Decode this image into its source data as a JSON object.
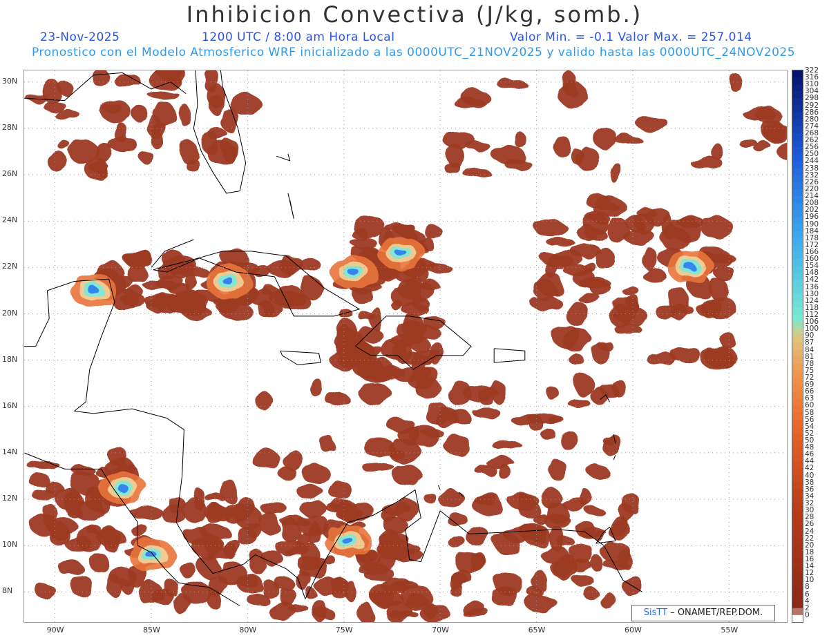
{
  "header": {
    "title": "Inhibicion Convectiva (J/kg, somb.)",
    "date": "23-Nov-2025",
    "time": "1200 UTC / 8:00 am Hora Local",
    "minmax": "Valor Min. = -0.1  Valor Max. = 257.014",
    "model_info": "Pronostico con el Modelo Atmosferico WRF inicializado a las 0000UTC_21NOV2025 y valido hasta las  0000UTC_24NOV2025"
  },
  "map": {
    "lat_labels": [
      "30N",
      "28N",
      "26N",
      "24N",
      "22N",
      "20N",
      "18N",
      "16N",
      "14N",
      "12N",
      "10N",
      "8N"
    ],
    "lon_labels": [
      "90W",
      "85W",
      "80W",
      "75W",
      "70W",
      "65W",
      "60W",
      "55W"
    ],
    "lat_values": [
      30,
      28,
      26,
      24,
      22,
      20,
      18,
      16,
      14,
      12,
      10,
      8
    ],
    "lon_values": [
      -90,
      -85,
      -80,
      -75,
      -70,
      -65,
      -60,
      -55
    ],
    "lon_range": [
      -91.6,
      -52.0
    ],
    "lat_range": [
      6.7,
      30.5
    ]
  },
  "colorbar": {
    "labels": [
      "322",
      "316",
      "310",
      "304",
      "298",
      "292",
      "286",
      "280",
      "274",
      "268",
      "262",
      "256",
      "250",
      "244",
      "238",
      "232",
      "226",
      "220",
      "214",
      "208",
      "202",
      "196",
      "190",
      "184",
      "178",
      "172",
      "166",
      "160",
      "154",
      "148",
      "142",
      "136",
      "130",
      "124",
      "118",
      "112",
      "106",
      "100",
      "90",
      "87",
      "84",
      "81",
      "78",
      "75",
      "72",
      "69",
      "66",
      "63",
      "60",
      "58",
      "56",
      "54",
      "52",
      "50",
      "48",
      "46",
      "44",
      "42",
      "40",
      "38",
      "36",
      "34",
      "32",
      "30",
      "28",
      "26",
      "24",
      "22",
      "20",
      "18",
      "16",
      "14",
      "12",
      "10",
      "8",
      "6",
      "4",
      "2",
      "0"
    ]
  },
  "credit": {
    "brand": "SisTT",
    "text": " – ONAMET/REP.DOM."
  }
}
